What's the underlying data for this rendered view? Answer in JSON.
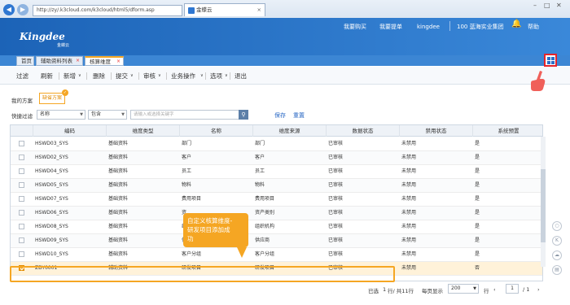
{
  "browser": {
    "url": "http://zy/.k3cloud.com/k3cloud/html5/dform.asp",
    "tab_title": "金蝶云",
    "back_icon": "arrow-left-icon",
    "forward_icon": "arrow-right-icon"
  },
  "header": {
    "logo": "Kingdee",
    "logo_sub": "金蝶云",
    "links": [
      "我要购买",
      "我要提单",
      "kingdee",
      "100 蓝海实业集团",
      "帮助"
    ],
    "search_placeholder": "搜索"
  },
  "app_tabs": [
    "首页",
    "辅助资料列表",
    "核算维度"
  ],
  "toolbar": [
    "过滤",
    "刷新",
    "新增",
    "删除",
    "提交",
    "审核",
    "业务操作",
    "选项",
    "退出"
  ],
  "scheme": {
    "label": "我的方案",
    "default_scheme": "缺省方案"
  },
  "filter": {
    "label": "快捷过滤",
    "field": "名称",
    "operator": "包含",
    "placeholder": "请输入或选择关键字",
    "save": "保存",
    "reset": "重置"
  },
  "table": {
    "columns": [
      "编码",
      "维度类型",
      "名称",
      "维度来源",
      "数据状态",
      "禁用状态",
      "系统预置"
    ],
    "rows": [
      [
        "HSWD03_SYS",
        "基础资料",
        "部门",
        "部门",
        "已审核",
        "未禁用",
        "是"
      ],
      [
        "HSWD02_SYS",
        "基础资料",
        "客户",
        "客户",
        "已审核",
        "未禁用",
        "是"
      ],
      [
        "HSWD04_SYS",
        "基础资料",
        "员工",
        "员工",
        "已审核",
        "未禁用",
        "是"
      ],
      [
        "HSWD05_SYS",
        "基础资料",
        "物料",
        "物料",
        "已审核",
        "未禁用",
        "是"
      ],
      [
        "HSWD07_SYS",
        "基础资料",
        "费用项目",
        "费用项目",
        "已审核",
        "未禁用",
        "是"
      ],
      [
        "HSWD06_SYS",
        "基础资料",
        "资",
        "资产类别",
        "已审核",
        "未禁用",
        "是"
      ],
      [
        "HSWD08_SYS",
        "基础资料",
        "组",
        "组织机构",
        "已审核",
        "未禁用",
        "是"
      ],
      [
        "HSWD09_SYS",
        "基础资料",
        "供",
        "供应商",
        "已审核",
        "未禁用",
        "是"
      ],
      [
        "HSWD10_SYS",
        "基础资料",
        "客户分组",
        "客户分组",
        "已审核",
        "未禁用",
        "是"
      ],
      [
        "ZDY0001",
        "辅助资料",
        "研发项目",
        "研发项目",
        "已审核",
        "未禁用",
        "否"
      ]
    ]
  },
  "callout": [
    "自定义核算维度-",
    "研发项目添加成",
    "功"
  ],
  "footer": {
    "selected": "已选",
    "selected_count": "1",
    "row_unit": "行/ 共11行",
    "per_page_label": "每页显示",
    "per_page": "200",
    "row_label": "行",
    "page_current": "1",
    "page_total": "/ 1"
  }
}
